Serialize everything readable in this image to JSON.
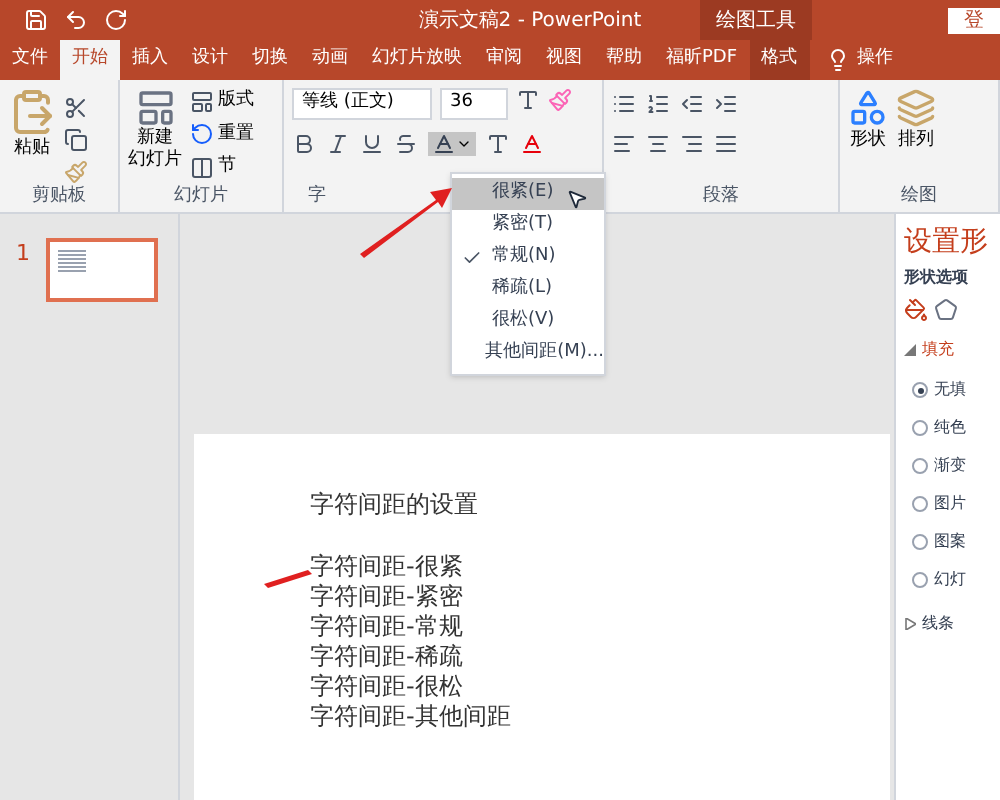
{
  "window": {
    "title": "演示文稿2 - PowerPoint",
    "context_group": "绘图工具",
    "login": "登"
  },
  "tabs": [
    {
      "label": "文件",
      "selected": false,
      "context": false
    },
    {
      "label": "开始",
      "selected": true,
      "context": false
    },
    {
      "label": "插入",
      "selected": false,
      "context": false
    },
    {
      "label": "设计",
      "selected": false,
      "context": false
    },
    {
      "label": "切换",
      "selected": false,
      "context": false
    },
    {
      "label": "动画",
      "selected": false,
      "context": false
    },
    {
      "label": "幻灯片放映",
      "selected": false,
      "context": false
    },
    {
      "label": "审阅",
      "selected": false,
      "context": false
    },
    {
      "label": "视图",
      "selected": false,
      "context": false
    },
    {
      "label": "帮助",
      "selected": false,
      "context": false
    },
    {
      "label": "福昕PDF",
      "selected": false,
      "context": false
    },
    {
      "label": "格式",
      "selected": false,
      "context": true
    }
  ],
  "tell_me": "操作",
  "clipboard": {
    "paste": "粘贴",
    "label": "剪贴板"
  },
  "slides_group": {
    "new_top": "新建",
    "new_bottom": "幻灯片",
    "layout": "版式",
    "reset": "重置",
    "section": "节",
    "label": "幻灯片"
  },
  "font_group": {
    "name": "等线 (正文)",
    "size": "36",
    "label": "字"
  },
  "paragraph_group": {
    "label": "段落"
  },
  "drawing_group": {
    "shape": "形状",
    "arrange": "排列",
    "label": "绘图"
  },
  "spacing_menu": [
    {
      "label": "很紧(E)",
      "selected": true,
      "checked": false
    },
    {
      "label": "紧密(T)",
      "selected": false,
      "checked": false
    },
    {
      "label": "常规(N)",
      "selected": false,
      "checked": true
    },
    {
      "label": "稀疏(L)",
      "selected": false,
      "checked": false
    },
    {
      "label": "很松(V)",
      "selected": false,
      "checked": false
    },
    {
      "label": "其他间距(M)...",
      "selected": false,
      "checked": false
    }
  ],
  "thumbnails": [
    {
      "number": "1",
      "selected": true
    }
  ],
  "slide": {
    "title": "字符间距的设置",
    "lines": [
      "字符间距-很紧",
      "字符间距-紧密",
      "字符间距-常规",
      "字符间距-稀疏",
      "字符间距-很松",
      "字符间距-其他间距"
    ]
  },
  "format_pane": {
    "title": "设置形",
    "tab": "形状选项",
    "fill": {
      "label": "填充",
      "expanded": true
    },
    "options": [
      {
        "label": "无填",
        "selected": true
      },
      {
        "label": "纯色",
        "selected": false
      },
      {
        "label": "渐变",
        "selected": false
      },
      {
        "label": "图片",
        "selected": false
      },
      {
        "label": "图案",
        "selected": false
      },
      {
        "label": "幻灯",
        "selected": false
      }
    ],
    "line": {
      "label": "线条",
      "expanded": false
    }
  }
}
